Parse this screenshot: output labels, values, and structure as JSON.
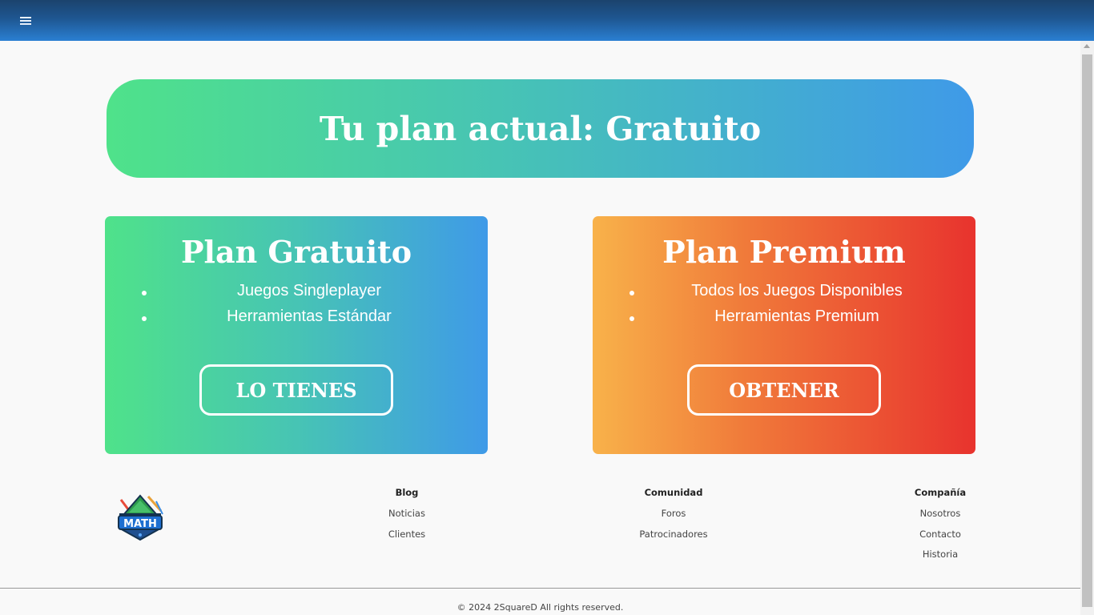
{
  "header": {
    "menu_icon": "hamburger-icon"
  },
  "banner": {
    "title": "Tu plan actual: Gratuito"
  },
  "plans": [
    {
      "title": "Plan Gratuito",
      "features": [
        "Juegos Singleplayer",
        "Herramientas Estándar"
      ],
      "button_label": "LO TIENES",
      "gradient": [
        "#4fe28a",
        "#3f9ae8"
      ]
    },
    {
      "title": "Plan Premium",
      "features": [
        "Todos los Juegos Disponibles",
        "Herramientas Premium"
      ],
      "button_label": "OBTENER",
      "gradient": [
        "#f8b24a",
        "#e8332e"
      ]
    }
  ],
  "footer": {
    "logo_text": "MATH",
    "columns": [
      {
        "heading": "Blog",
        "links": [
          "Noticias",
          "Clientes"
        ]
      },
      {
        "heading": "Comunidad",
        "links": [
          "Foros",
          "Patrocinadores"
        ]
      },
      {
        "heading": "Compañía",
        "links": [
          "Nosotros",
          "Contacto",
          "Historia"
        ]
      }
    ],
    "copyright": "© 2024 2SquareD All rights reserved."
  }
}
